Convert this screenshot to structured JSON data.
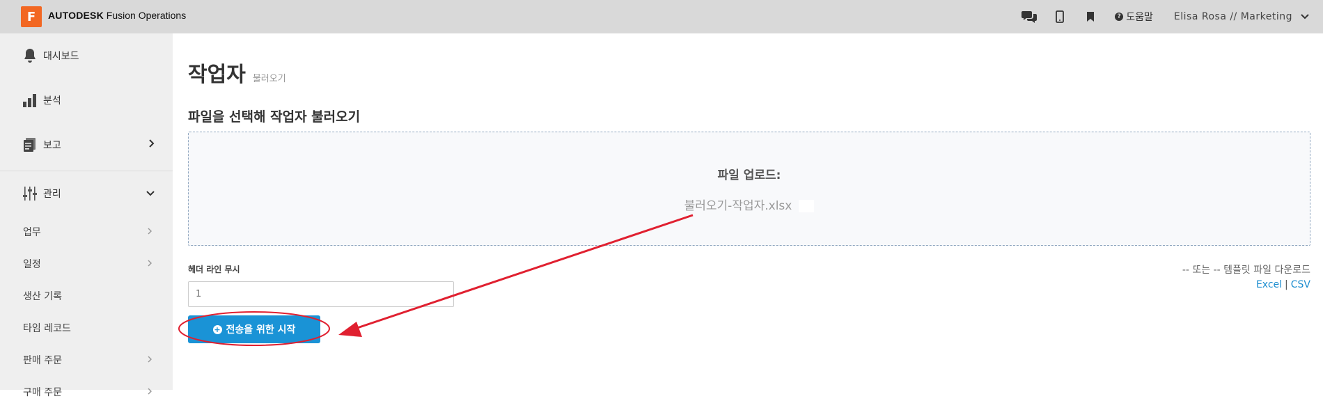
{
  "topbar": {
    "logo_letter": "F",
    "brand_bold": "AUTODESK",
    "brand_rest": "Fusion Operations",
    "help_label": "도움말",
    "user_label": "Elisa Rosa // Marketing",
    "icons": [
      "chat-icon",
      "mobile-icon",
      "bookmark-icon",
      "help-circle-icon",
      "chevron-down-icon"
    ]
  },
  "sidebar": {
    "top_items": [
      {
        "label": "대시보드",
        "icon": "bell-icon"
      },
      {
        "label": "분석",
        "icon": "bar-chart-icon"
      },
      {
        "label": "보고",
        "icon": "report-icon"
      },
      {
        "label": "관리",
        "icon": "sliders-icon"
      }
    ],
    "sub_items": [
      {
        "label": "업무"
      },
      {
        "label": "일정"
      },
      {
        "label": "생산 기록"
      },
      {
        "label": "타임 레코드"
      },
      {
        "label": "판매 주문"
      },
      {
        "label": "구매 주문"
      }
    ]
  },
  "main": {
    "title": "작업자",
    "subtitle": "불러오기",
    "section_title": "파일을 선택해 작업자 불러오기",
    "dropzone_label": "파일 업로드:",
    "dropzone_file": "불러오기-작업자.xlsx",
    "ignore_header_label": "헤더 라인 무시",
    "ignore_header_value": "1",
    "template_note": "-- 또는 -- 템플릿 파일 다운로드",
    "template_excel": "Excel",
    "template_separator": "|",
    "template_csv": "CSV",
    "start_button": "전송을 위한 시작"
  },
  "annotation_color": "#e02030",
  "accent_color": "#1a93d6"
}
